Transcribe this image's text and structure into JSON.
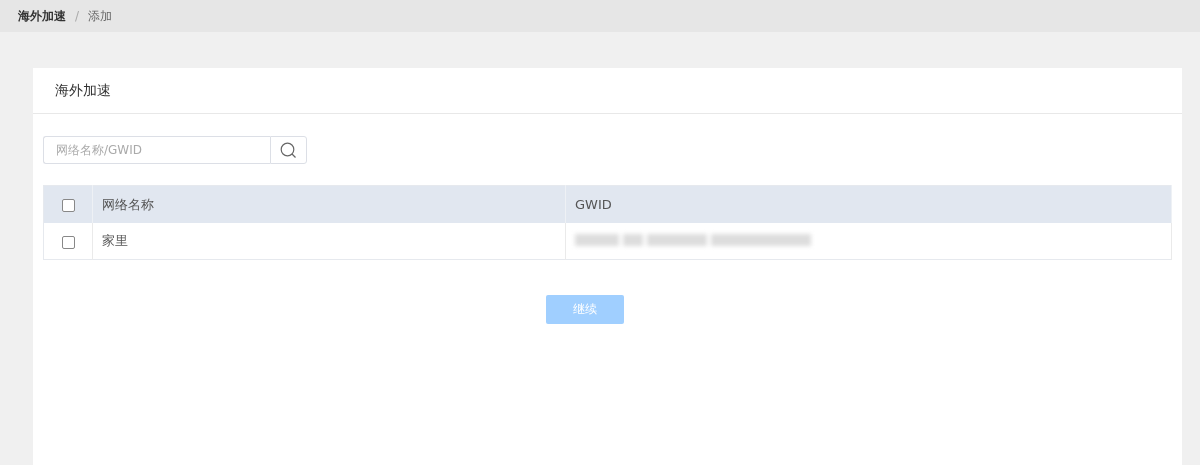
{
  "breadcrumb": [
    {
      "label": "海外加速",
      "current": false
    },
    {
      "label": "添加",
      "current": true
    }
  ],
  "breadcrumb_separator": "/",
  "card": {
    "title": "海外加速"
  },
  "search": {
    "placeholder": "网络名称/GWID"
  },
  "table": {
    "select_all_checked": false,
    "columns": [
      "网络名称",
      "GWID"
    ],
    "rows": [
      {
        "checked": false,
        "name": "家里",
        "gwid_redacted": true
      }
    ]
  },
  "continue_button": {
    "label": "继续",
    "disabled": true
  }
}
